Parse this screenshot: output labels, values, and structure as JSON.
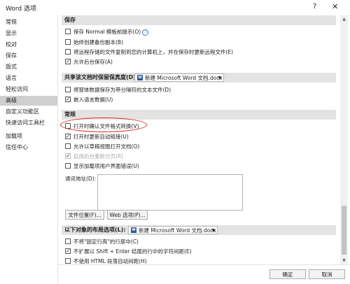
{
  "window": {
    "title": "Word 选项",
    "help_label": "?",
    "close_label": "✕"
  },
  "sidebar": {
    "items": [
      "常规",
      "显示",
      "校对",
      "保存",
      "版式",
      "语言",
      "轻松访问",
      "高级",
      "自定义功能区",
      "快速访问工具栏",
      "加载项",
      "信任中心"
    ],
    "active_index": 7
  },
  "sections": {
    "save": {
      "header": "保存",
      "options": [
        {
          "label": "保存 Normal 模板前提示(O)",
          "checked": false,
          "info": true
        },
        {
          "label": "始终创建备份副本(B)",
          "checked": false
        },
        {
          "label": "将远程存储的文件复制到您的计算机上，并在保存时更新远程文件(E)",
          "checked": false
        },
        {
          "label": "允许后台保存(A)",
          "checked": true
        }
      ]
    },
    "fidelity": {
      "header": "共享该文档时保留保真度(D):",
      "doc": "新建 Microsoft Word 文档.docx",
      "options": [
        {
          "label": "将窗体数据保存为带分隔符的文本文件(D)",
          "checked": false
        },
        {
          "label": "嵌入语言数据(U)",
          "checked": true
        }
      ]
    },
    "general": {
      "header": "常规",
      "options": [
        {
          "label": "打开时确认文件格式转换(V)",
          "checked": false,
          "disabled": false
        },
        {
          "label": "打开时更新自动链接(U)",
          "checked": true,
          "disabled": false
        },
        {
          "label": "允许以草稿视图打开文档(O)",
          "checked": false,
          "disabled": false
        },
        {
          "label": "启用后台重新分页(R)",
          "checked": true,
          "disabled": true
        },
        {
          "label": "显示加载项用户界面错误(U)",
          "checked": false,
          "disabled": false
        }
      ],
      "mailing_label": "通讯地址(D):",
      "file_locations_button": "文件位置(F)...",
      "web_options_button": "Web 选项(P)..."
    },
    "layout": {
      "header": "以下对象的布局选项(L):",
      "doc": "新建 Microsoft Word 文档.docx",
      "options": [
        {
          "label": "不将\"固定行高\"的行居中(C)",
          "checked": false
        },
        {
          "label": "不扩展以 Shift + Enter 结尾的行中的字符间距(E)",
          "checked": true
        },
        {
          "label": "不使用 HTML 段落自动间距(H)",
          "checked": false
        }
      ]
    }
  },
  "footer": {
    "ok_label": "确定",
    "cancel_label": "取消"
  },
  "scroll": {
    "up": "▲",
    "down": "▼"
  },
  "colors": {
    "annotation": "#d81e1e",
    "active_nav": "#cfcfcf",
    "section_header": "#e3e3e3"
  }
}
